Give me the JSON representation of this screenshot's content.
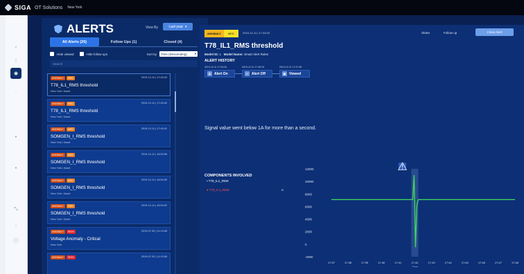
{
  "app": {
    "brand": "SIGA",
    "product": "OT Solutions",
    "location": "New York"
  },
  "panel": {
    "title": "ALERTS",
    "view_by_label": "View By",
    "view_by_value": "Last year",
    "tabs": [
      "All Alerts (26)",
      "Follow Ups (1)",
      "Closed (4)"
    ],
    "hide_viewed": "Hide viewed",
    "hide_follow_ups": "Hide follow ups",
    "sort_by_label": "Sort by",
    "sort_value": "Time (Descending)",
    "search_placeholder": "Search"
  },
  "alerts": [
    {
      "type": "ANOMALY",
      "severity": "MED",
      "time": "2019-12-11 | 17:43:43",
      "title": "T78_IL1_RMS threshold",
      "location": "New York / Asset"
    },
    {
      "type": "ANOMALY",
      "severity": "MED",
      "time": "2019-12-11 | 17:43:42",
      "title": "T78_IL1_RMS threshold",
      "location": "New York / Asset"
    },
    {
      "type": "ANOMALY",
      "severity": "MED",
      "time": "2019-12-11 | 17:43:41",
      "title": "SOMGEN_I_RMS threshold",
      "location": "New York / Asset"
    },
    {
      "type": "ANOMALY",
      "severity": "MED",
      "time": "2019-12-11 | 16:53:08",
      "title": "SOMGEN_I_RMS threshold",
      "location": "New York / Asset"
    },
    {
      "type": "ANOMALY",
      "severity": "MED",
      "time": "2019-12-11 | 16:53:05",
      "title": "SOMGEN_I_RMS threshold",
      "location": "New York / Asset"
    },
    {
      "type": "ANOMALY",
      "severity": "MED",
      "time": "2019-12-11 | 16:53:02",
      "title": "SOMGEN_I_RMS threshold",
      "location": "New York / Asset"
    },
    {
      "type": "ANOMALY",
      "severity": "HIGH",
      "time": "2019-07-30 | 11:13:08",
      "title": "Voltage Anomaly - Critical",
      "location": "New York"
    },
    {
      "type": "ANOMALY",
      "severity": "HIGH",
      "time": "2019-07-30 | 11:13:08",
      "title": "",
      "location": ""
    }
  ],
  "detail": {
    "type": "ANOMALY",
    "severity": "MED",
    "time": "2019-12-11 | 17:43:43",
    "share": "Share",
    "follow": "Follow up",
    "close": "Close Alert",
    "title": "T78_IL1_RMS threshold",
    "model_id_label": "Model ID:",
    "model_id": "1",
    "model_name_label": "Model Name:",
    "model_name": "Smart Alert Rules",
    "history_title": "ALERT HISTORY",
    "history": [
      {
        "time": "2019-12-11 17:43:43",
        "label": "Alert On",
        "icon": "warning"
      },
      {
        "time": "2019-12-11 17:45:23",
        "label": "Alert Off",
        "icon": "check"
      },
      {
        "time": "2019-12-11 17:47:08",
        "label": "Viewed",
        "icon": "eye"
      }
    ],
    "message": "Signal value went below 1A for more than a second.",
    "components_title": "COMPONENTS INVOLVED",
    "components": [
      {
        "name": "T78_IL1_RMS",
        "color": "#ffffff"
      },
      {
        "name": "T78_IL1_RMS",
        "color": "#ff4b4b"
      }
    ],
    "component_unit": "A"
  },
  "chart_data": {
    "type": "line",
    "x": [
      "17:37",
      "17:38",
      "17:39",
      "17:40",
      "17:41",
      "17:42",
      "17:43",
      "17:44",
      "17:45",
      "17:46",
      "17:47",
      "17:48"
    ],
    "series": [
      {
        "values": [
          7100,
          7100,
          7100,
          7100,
          7100,
          7100,
          7100,
          7100,
          7100,
          7100,
          7100,
          7100
        ]
      }
    ],
    "spike_at": "17:42",
    "ylim": [
      -2000,
      12000
    ],
    "yticks": [
      12000,
      10000,
      8000,
      6000,
      4000,
      2000,
      0,
      -2000
    ],
    "xlabel": "Time",
    "color": "#3fd65a"
  }
}
